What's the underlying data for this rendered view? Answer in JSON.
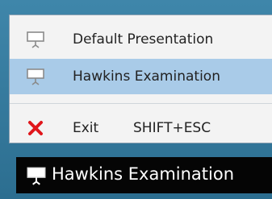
{
  "jump_list": {
    "items": [
      {
        "label": "Default Presentation",
        "icon": "presentation-screen-icon"
      },
      {
        "label": "Hawkins Examination",
        "icon": "presentation-screen-icon",
        "highlighted": true
      },
      {
        "label": "Exit",
        "icon": "close-x-icon",
        "shortcut": "SHIFT+ESC"
      }
    ]
  },
  "taskbar": {
    "button_label": "Hawkins Examination",
    "icon": "presentation-screen-icon"
  },
  "colors": {
    "menu_background": "#f3f3f3",
    "highlight": "#a9cbe8",
    "exit_icon": "#e0161b",
    "taskbar_background": "#050505",
    "desktop_accent": "#2f6f8f"
  }
}
